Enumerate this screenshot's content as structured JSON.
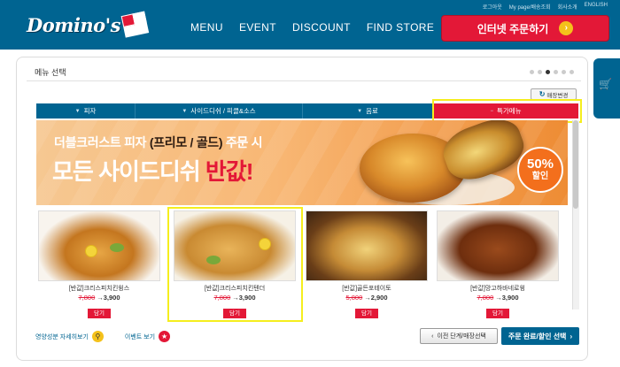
{
  "header": {
    "logo_text": "Domino's",
    "nav": [
      "MENU",
      "EVENT",
      "DISCOUNT",
      "FIND STORE"
    ],
    "util_links": [
      "로그아웃",
      "My page/배송조회",
      "회사소개",
      "ENGLISH"
    ],
    "order_button": "인터넷 주문하기",
    "bg_color": "#006491",
    "accent_color": "#e31837"
  },
  "panel": {
    "title": "메뉴 선택",
    "change_store": "매장변경",
    "pager_dots": 6,
    "active_dot": 3
  },
  "tabs": [
    {
      "label": "피자",
      "active": false
    },
    {
      "label": "사이드디쉬 / 피클&소스",
      "active": false
    },
    {
      "label": "음료",
      "active": false
    },
    {
      "label": "특가메뉴",
      "active": true
    }
  ],
  "banner": {
    "line1_pre": "더블크러스트 피자 ",
    "line1_hl": "(프리모 / 골드)",
    "line1_post": " 주문 시",
    "line2_pre": "모든 사이드디쉬 ",
    "line2_hl": "반값!",
    "badge_pct": "50%",
    "badge_word": "할인"
  },
  "products": [
    {
      "name": "[반값]크리스피치킨윙스",
      "old_price": "7,800",
      "arrow": "→",
      "new_price": "3,900",
      "button": "담기"
    },
    {
      "name": "[반값]크리스피치킨텐더",
      "old_price": "7,800",
      "arrow": "→",
      "new_price": "3,900",
      "button": "담기"
    },
    {
      "name": "[반값]골든포테이토",
      "old_price": "5,800",
      "arrow": "→",
      "new_price": "2,900",
      "button": "담기"
    },
    {
      "name": "[반값]망고하바네로윙",
      "old_price": "7,800",
      "arrow": "→",
      "new_price": "3,900",
      "button": "담기"
    }
  ],
  "footer": {
    "nutrition_link": "영양성분 자세히보기",
    "event_link": "이벤트 보기",
    "prev_button": "이전 단계/매장선택",
    "next_button": "주문 완료/할인 선택"
  }
}
